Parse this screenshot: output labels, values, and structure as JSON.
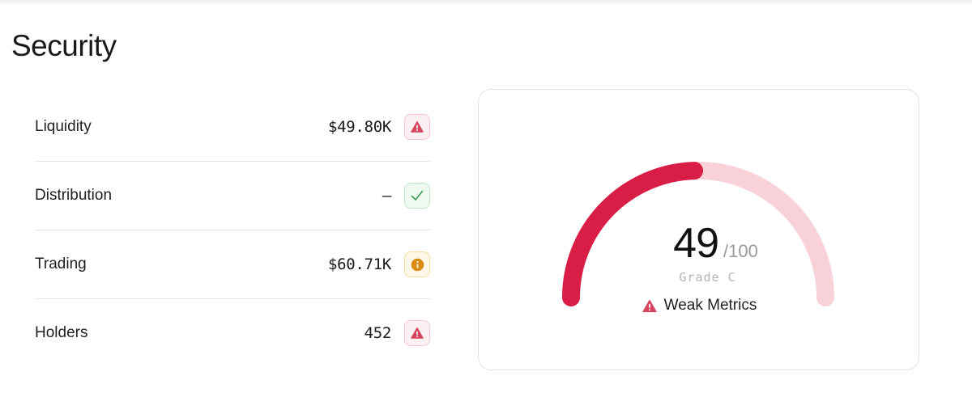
{
  "page": {
    "title": "Security"
  },
  "metrics": [
    {
      "label": "Liquidity",
      "value": "$49.80K",
      "status": "danger",
      "icon": "warning-triangle-icon"
    },
    {
      "label": "Distribution",
      "value": "—",
      "status": "success",
      "icon": "check-icon"
    },
    {
      "label": "Trading",
      "value": "$60.71K",
      "status": "info",
      "icon": "info-circle-icon"
    },
    {
      "label": "Holders",
      "value": "452",
      "status": "danger",
      "icon": "warning-triangle-icon"
    }
  ],
  "score": {
    "value": "49",
    "max": "/100",
    "level": 0.49,
    "grade": "Grade C",
    "status_text": "Weak Metrics",
    "status_icon": "warning-triangle-icon"
  },
  "colors": {
    "danger": "#d81e46",
    "danger_light": "#f8d2d8",
    "success": "#3e9a55",
    "info": "#d98b12"
  }
}
